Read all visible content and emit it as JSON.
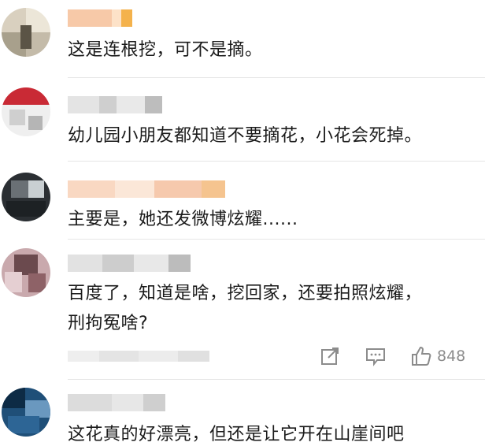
{
  "comments": [
    {
      "username": "",
      "text": "这是连根挖，可不是摘。",
      "avatar": "avatar-pixelated",
      "colors": [
        "#d9d0bf",
        "#a8a08c",
        "#ece6d8",
        "#5b5446"
      ]
    },
    {
      "username": "",
      "text": "幼儿园小朋友都知道不要摘花，小花会死掉。",
      "avatar": "avatar-pixelated",
      "colors": [
        "#d7242f",
        "#f0f0f0",
        "#b5b5b5",
        "#c92a35"
      ]
    },
    {
      "username": "",
      "text": "主要是，她还发微博炫耀......",
      "avatar": "avatar-pixelated",
      "colors": [
        "#2b2f33",
        "#6a7075",
        "#c9cfd2",
        "#1d2124"
      ]
    },
    {
      "username": "",
      "text_lines": [
        "百度了，知道是啥，挖回家，还要拍照炫耀，",
        "刑拘冤啥?"
      ],
      "avatar": "avatar-pixelated",
      "colors": [
        "#c9a9ad",
        "#6b4a4e",
        "#e5cfd2",
        "#8e6267"
      ],
      "actions": {
        "share_icon": "share-icon",
        "comment_icon": "comment-icon",
        "like_icon": "thumbs-up-icon",
        "like_count": "848"
      }
    },
    {
      "username": "",
      "text": "这花真的好漂亮，但还是让它开在山崖间吧",
      "avatar": "avatar-pixelated",
      "colors": [
        "#1f4f78",
        "#0d2b45",
        "#6a98bf",
        "#2d6595"
      ]
    }
  ]
}
